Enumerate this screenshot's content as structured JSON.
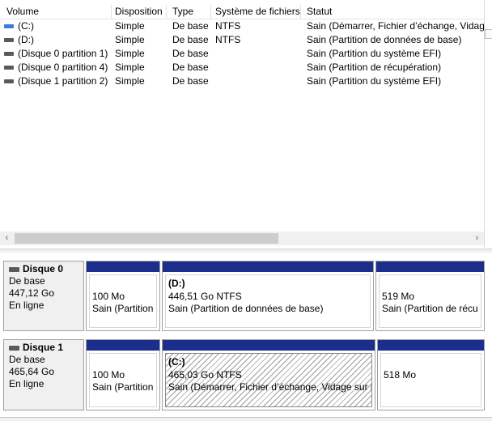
{
  "columns": [
    "Volume",
    "Disposition",
    "Type",
    "Système de fichiers",
    "Statut"
  ],
  "volumes": [
    {
      "icon": "windows-volume-icon",
      "name": "(C:)",
      "layout": "Simple",
      "type": "De base",
      "fs": "NTFS",
      "status": "Sain (Démarrer, Fichier d’échange, Vidage"
    },
    {
      "icon": "disk-volume-icon",
      "name": "(D:)",
      "layout": "Simple",
      "type": "De base",
      "fs": "NTFS",
      "status": "Sain (Partition de données de base)"
    },
    {
      "icon": "disk-volume-icon",
      "name": "(Disque 0 partition 1)",
      "layout": "Simple",
      "type": "De base",
      "fs": "",
      "status": "Sain (Partition du système EFI)"
    },
    {
      "icon": "disk-volume-icon",
      "name": "(Disque 0 partition 4)",
      "layout": "Simple",
      "type": "De base",
      "fs": "",
      "status": "Sain (Partition de récupération)"
    },
    {
      "icon": "disk-volume-icon",
      "name": "(Disque 1 partition 2)",
      "layout": "Simple",
      "type": "De base",
      "fs": "",
      "status": "Sain (Partition du système EFI)"
    }
  ],
  "scroll": {
    "left_arrow": "‹",
    "right_arrow": "›"
  },
  "disks": [
    {
      "title": "Disque 0",
      "type": "De base",
      "size": "447,12 Go",
      "state": "En ligne",
      "partitions": [
        {
          "name": "",
          "size": "100 Mo",
          "status": "Sain (Partition",
          "selected": false
        },
        {
          "name": "(D:)",
          "size": "446,51 Go NTFS",
          "status": "Sain (Partition de données de base)",
          "selected": false
        },
        {
          "name": "",
          "size": "519 Mo",
          "status": "Sain (Partition de récu",
          "selected": false
        }
      ]
    },
    {
      "title": "Disque 1",
      "type": "De base",
      "size": "465,64 Go",
      "state": "En ligne",
      "partitions": [
        {
          "name": "",
          "size": "100 Mo",
          "status": "Sain (Partition",
          "selected": false
        },
        {
          "name": "(C:)",
          "size": "465,03 Go NTFS",
          "status": "Sain (Démarrer, Fichier d’échange, Vidage sur in",
          "selected": true
        },
        {
          "name": "",
          "size": "518 Mo",
          "status": "",
          "selected": false
        }
      ]
    }
  ],
  "colors": {
    "partition_bar": "#1b2e8c",
    "window_bg": "#f0f0f0"
  }
}
